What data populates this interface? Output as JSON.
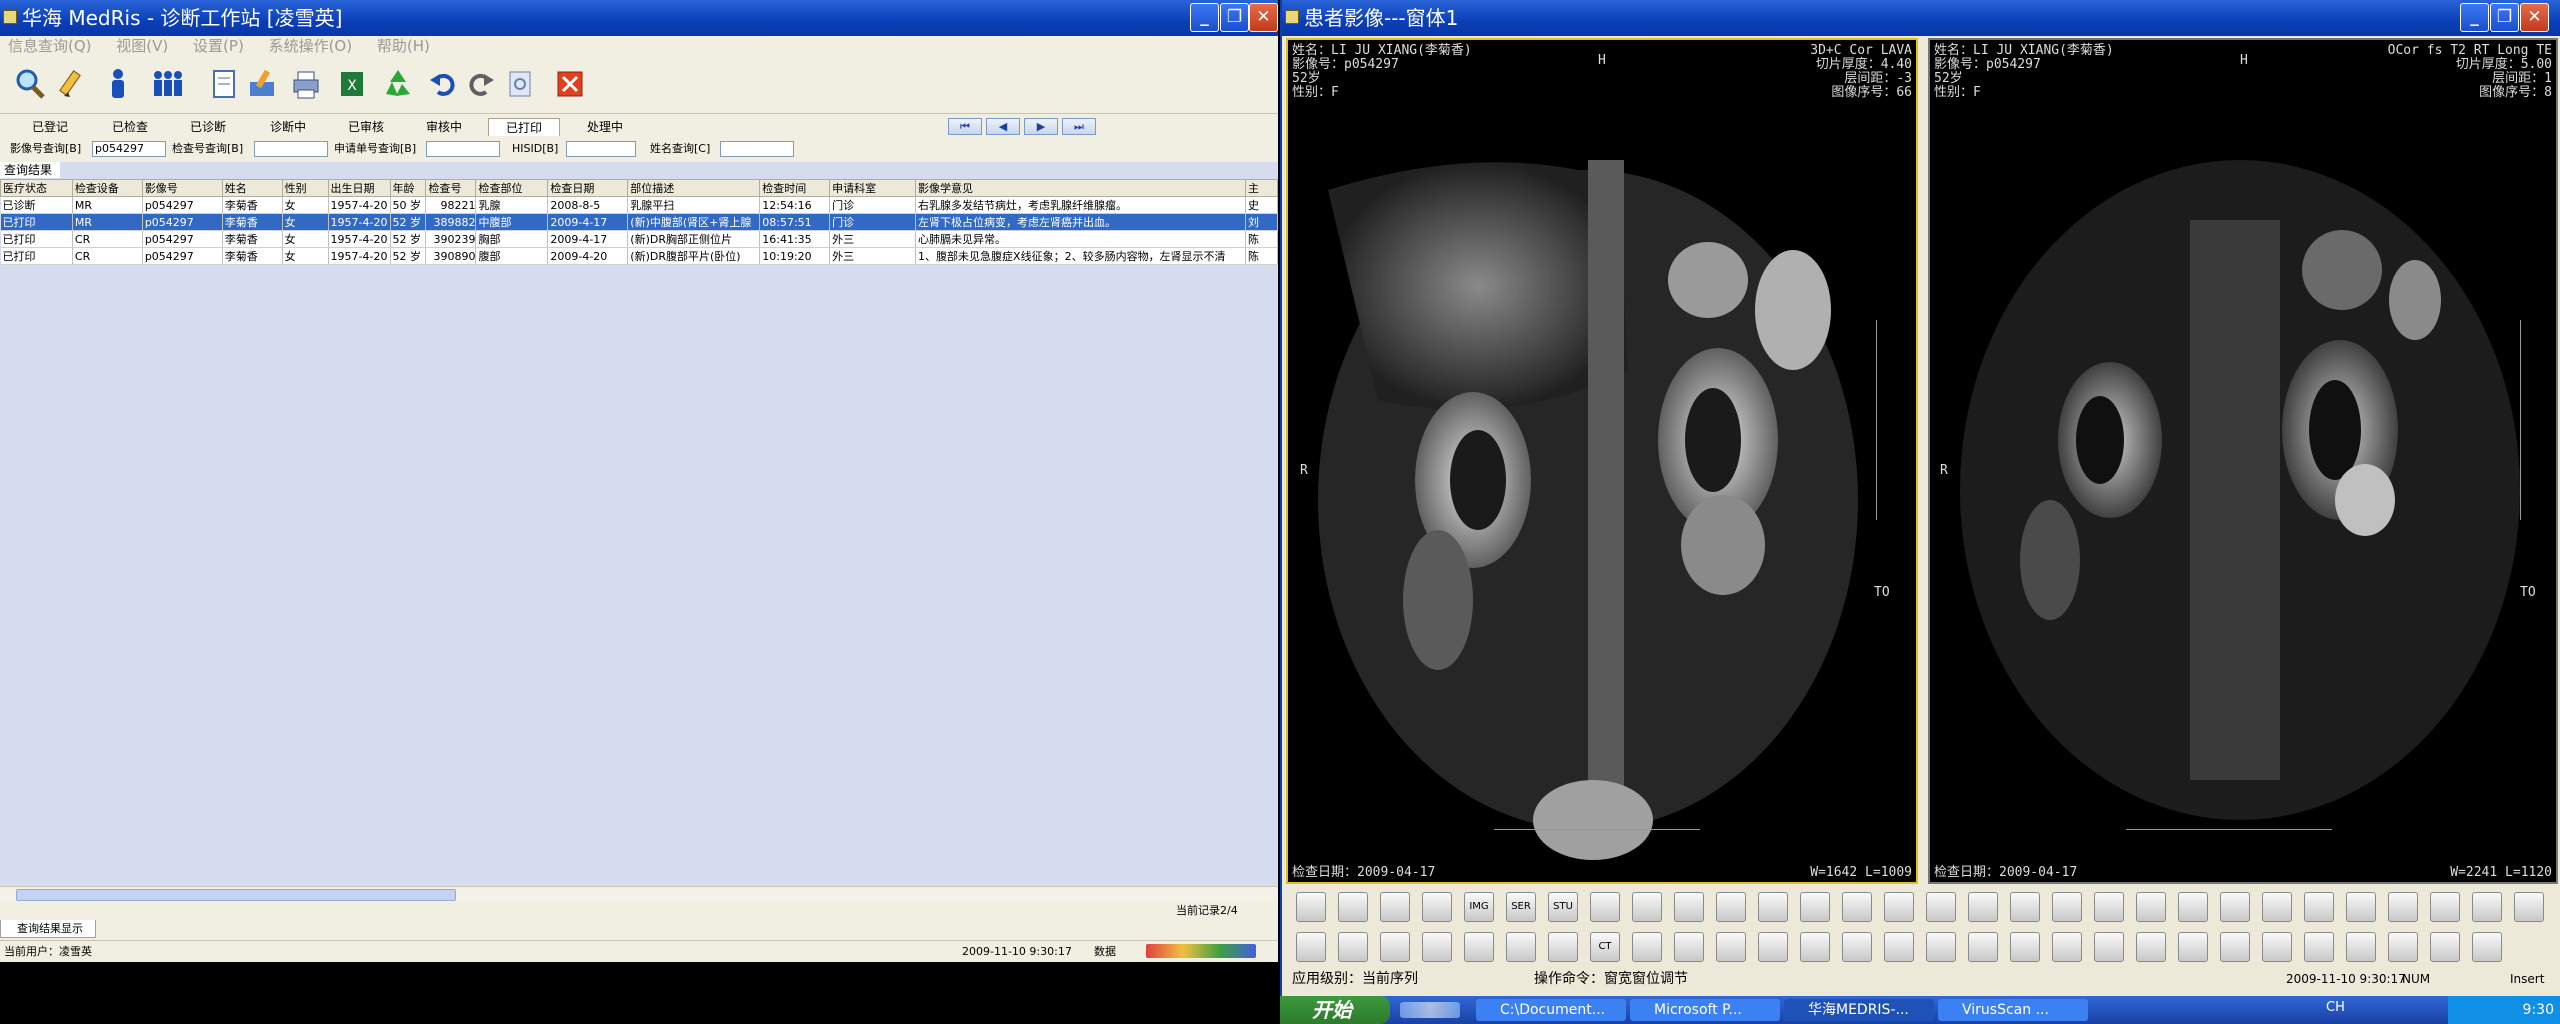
{
  "left_window": {
    "title": "华海 MedRis - 诊断工作站 [凌雪英]",
    "menu": [
      "信息查询(Q)",
      "视图(V)",
      "设置(P)",
      "系统操作(O)",
      "帮助(H)"
    ],
    "tabs": [
      "已登记",
      "已检查",
      "已诊断",
      "诊断中",
      "已审核",
      "审核中",
      "已打印",
      "处理中"
    ],
    "active_tab": "已打印",
    "nav_buttons": [
      "⏮",
      "◀",
      "▶",
      "⏭"
    ],
    "search": {
      "image_no_label": "影像号查询[B]",
      "image_no_value": "p054297",
      "exam_no_label": "检查号查询[B]",
      "exam_no_value": "",
      "request_no_label": "申请单号查询[B]",
      "request_no_value": "",
      "hisid_label": "HISID[B]",
      "hisid_value": "",
      "name_label": "姓名查询[C]",
      "name_value": ""
    },
    "results_title": "查询结果",
    "columns": [
      "医疗状态",
      "检查设备",
      "影像号",
      "姓名",
      "性别",
      "出生日期",
      "年龄",
      "检查号",
      "检查部位",
      "检查日期",
      "部位描述",
      "检查时间",
      "申请科室",
      "影像学意见",
      "主"
    ],
    "rows": [
      [
        "已诊断",
        "MR",
        "p054297",
        "李菊香",
        "女",
        "1957-4-20",
        "50 岁",
        "98221",
        "乳腺",
        "2008-8-5",
        "乳腺平扫",
        "12:54:16",
        "门诊",
        "右乳腺多发结节病灶，考虑乳腺纤维腺瘤。",
        "史"
      ],
      [
        "已打印",
        "MR",
        "p054297",
        "李菊香",
        "女",
        "1957-4-20",
        "52 岁",
        "389882",
        "中腹部",
        "2009-4-17",
        "(新)中腹部(肾区+肾上腺",
        "08:57:51",
        "门诊",
        "左肾下极占位病变，考虑左肾癌并出血。",
        "刘"
      ],
      [
        "已打印",
        "CR",
        "p054297",
        "李菊香",
        "女",
        "1957-4-20",
        "52 岁",
        "390239",
        "胸部",
        "2009-4-17",
        "(新)DR胸部正侧位片",
        "16:41:35",
        "外三",
        "心肺膈未见异常。",
        "陈"
      ],
      [
        "已打印",
        "CR",
        "p054297",
        "李菊香",
        "女",
        "1957-4-20",
        "52 岁",
        "390890",
        "腹部",
        "2009-4-20",
        "(新)DR腹部平片(卧位)",
        "10:19:20",
        "外三",
        "1、腹部未见急腹症X线征象；2、较多肠内容物，左肾显示不清",
        "陈"
      ]
    ],
    "selected_row": 1,
    "record_count": "当前记录2/4",
    "bottom_tab": "查询结果显示",
    "current_user": "当前用户：凌雪英",
    "datetime": "2009-11-10 9:30:17",
    "num": "数据"
  },
  "right_window": {
    "title": "患者影像---窗体1",
    "viewport1": {
      "name": "姓名：LI JU XIANG(李菊香)",
      "image_no": "影像号：p054297",
      "age": "52岁",
      "sex": "性别：F",
      "series": "3D+C Cor LAVA",
      "thickness": "切片厚度：4.40",
      "spacing": "层间距：-3",
      "image_index": "图像序号：66",
      "top_marker": "H",
      "left_marker": "R",
      "right_marker": "TO",
      "exam_date": "检查日期：2009-04-17",
      "window": "W=1642 L=1009"
    },
    "viewport2": {
      "name": "姓名：LI JU XIANG(李菊香)",
      "image_no": "影像号：p054297",
      "age": "52岁",
      "sex": "性别：F",
      "series": "OCor fs T2 RT Long TE",
      "thickness": "切片厚度：5.00",
      "spacing": "层间距：1",
      "image_index": "图像序号：8",
      "top_marker": "H",
      "left_marker": "R",
      "right_marker": "TO",
      "exam_date": "检查日期：2009-04-17",
      "window": "W=2241 L=1120"
    },
    "status_level": "应用级别：当前序列",
    "status_command": "操作命令：窗宽窗位调节",
    "datetime": "2009-11-10 9:30:17",
    "num": "NUM",
    "insert": "Insert",
    "toolbar_labels": [
      "IMG",
      "SER",
      "STU",
      "CT"
    ]
  },
  "taskbar": {
    "start": "开始",
    "tasks": [
      "C:\\Document...",
      "Microsoft P...",
      "华海MEDRIS-...",
      "VirusScan ..."
    ],
    "active_task": 2,
    "clock": "9:30",
    "ime": "CH"
  },
  "colors": {
    "title_blue": "#0a3fb8",
    "selection": "#316ac5",
    "viewport_active": "#e0c020",
    "grid_bg": "#d4dcee"
  }
}
